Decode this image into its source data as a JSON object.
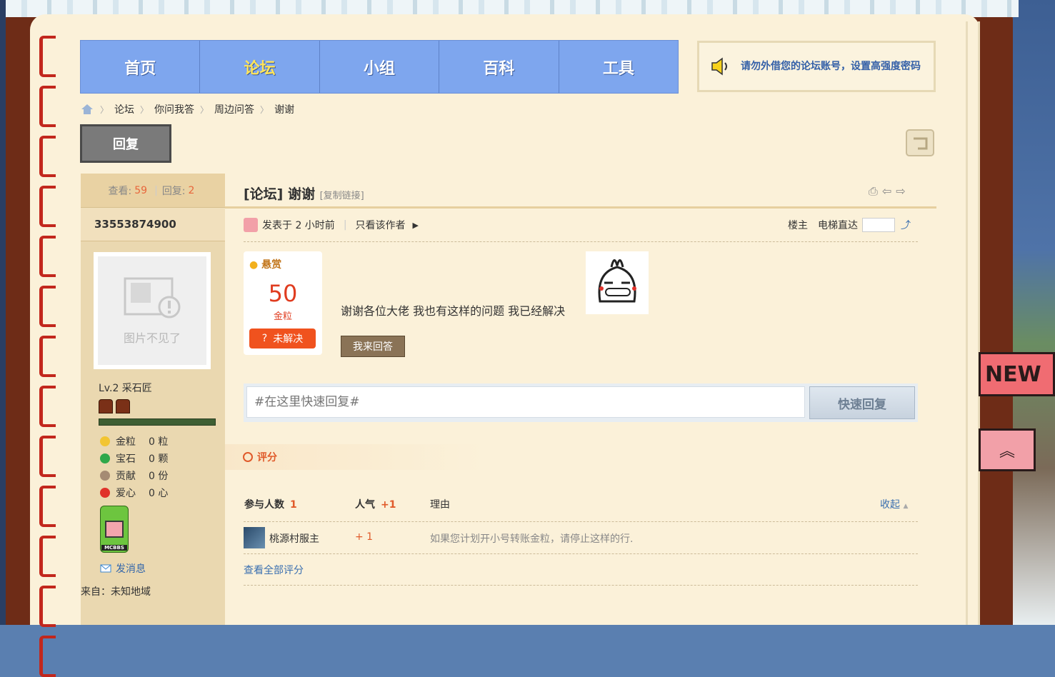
{
  "nav": {
    "items": [
      "首页",
      "论坛",
      "小组",
      "百科",
      "工具"
    ],
    "active_index": 1
  },
  "notice": {
    "text": "请勿外借您的论坛账号，设置高强度密码",
    "accent": "#3460a8"
  },
  "breadcrumb": [
    "论坛",
    "你问我答",
    "周边问答",
    "谢谢"
  ],
  "toolbar": {
    "reply_label": "回复"
  },
  "sidebar": {
    "views_label": "查看:",
    "views": "59",
    "replies_label": "回复:",
    "replies": "2",
    "username": "33553874900",
    "avatar_placeholder": "图片不见了",
    "level": "Lv.2 采石匠",
    "stats": [
      {
        "label": "金粒",
        "value": "0 粒",
        "color": "#f2c533"
      },
      {
        "label": "宝石",
        "value": "0 颗",
        "color": "#2fa84a"
      },
      {
        "label": "贡献",
        "value": "0 份",
        "color": "#a58b73"
      },
      {
        "label": "爱心",
        "value": "0 心",
        "color": "#e0322a"
      }
    ],
    "badge_text": "MCBBS",
    "send_message": "发消息",
    "from": "来自：未知地域"
  },
  "post": {
    "title": "[论坛] 谢谢",
    "copy_link": "[复制链接]",
    "posted": "发表于 2 小时前",
    "only_author": "只看该作者",
    "floor": "楼主",
    "jump_label": "电梯直达",
    "bounty_head": "悬赏",
    "bounty_amount": "50",
    "bounty_unit": "金粒",
    "bounty_status": "未解决",
    "body": "谢谢各位大佬 我也有这样的问题 我已经解决",
    "answer_button": "我来回答"
  },
  "quick_reply": {
    "placeholder": "#在这里快速回复#",
    "button": "快速回复"
  },
  "rating": {
    "tab_label": "评分",
    "participants_label": "参与人数",
    "participants": "1",
    "popularity_label": "人气",
    "popularity": "+1",
    "reason_label": "理由",
    "collapse": "收起",
    "rows": [
      {
        "user": "桃源村服主",
        "points": "+ 1",
        "reason": "如果您计划开小号转账金粒，请停止这样的行."
      }
    ],
    "view_all": "查看全部评分"
  },
  "side_tags": {
    "new": "NEW"
  }
}
